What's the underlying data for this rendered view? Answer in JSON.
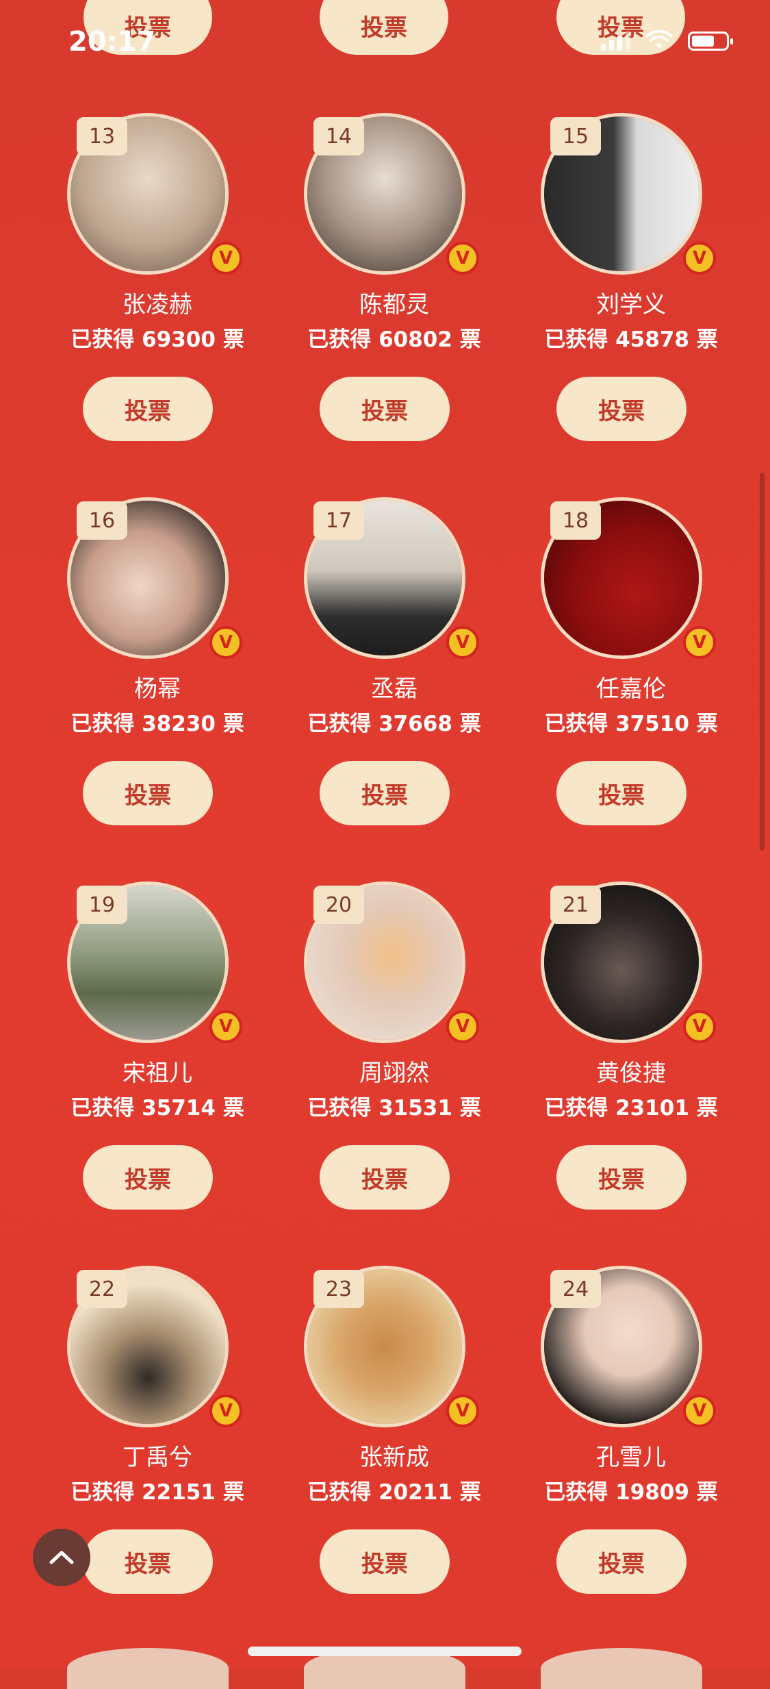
{
  "status_bar": {
    "time": "20:17"
  },
  "vote_label": "投票",
  "cards": [
    {
      "rank": "13",
      "name": "张凌赫",
      "votes_text": "已获得 69300 票",
      "badge": "V"
    },
    {
      "rank": "14",
      "name": "陈都灵",
      "votes_text": "已获得 60802 票",
      "badge": "V"
    },
    {
      "rank": "15",
      "name": "刘学义",
      "votes_text": "已获得 45878 票",
      "badge": "V"
    },
    {
      "rank": "16",
      "name": "杨幂",
      "votes_text": "已获得 38230 票",
      "badge": "V"
    },
    {
      "rank": "17",
      "name": "丞磊",
      "votes_text": "已获得 37668 票",
      "badge": "V"
    },
    {
      "rank": "18",
      "name": "任嘉伦",
      "votes_text": "已获得 37510 票",
      "badge": "V"
    },
    {
      "rank": "19",
      "name": "宋祖儿",
      "votes_text": "已获得 35714 票",
      "badge": "V"
    },
    {
      "rank": "20",
      "name": "周翊然",
      "votes_text": "已获得 31531 票",
      "badge": "V"
    },
    {
      "rank": "21",
      "name": "黄俊捷",
      "votes_text": "已获得 23101 票",
      "badge": "V"
    },
    {
      "rank": "22",
      "name": "丁禹兮",
      "votes_text": "已获得 22151 票",
      "badge": "V"
    },
    {
      "rank": "23",
      "name": "张新成",
      "votes_text": "已获得 20211 票",
      "badge": "V"
    },
    {
      "rank": "24",
      "name": "孔雪儿",
      "votes_text": "已获得 19809 票",
      "badge": "V"
    }
  ],
  "colors": {
    "background": "#e23b2f",
    "button_bg": "#f7e6c8",
    "button_text": "#c23a2a",
    "badge": "#f4c024"
  },
  "icons": [
    "signal-icon",
    "wifi-icon",
    "battery-icon",
    "chevron-up-icon"
  ]
}
